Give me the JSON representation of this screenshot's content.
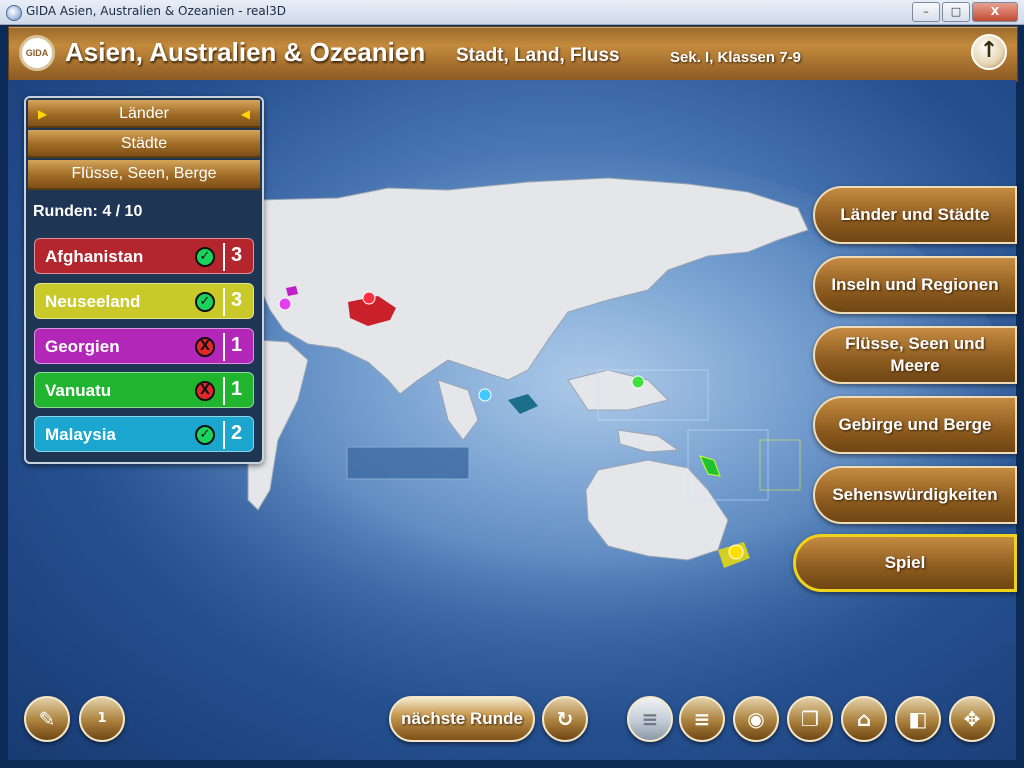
{
  "window": {
    "title": "GIDA Asien, Australien & Ozeanien - real3D",
    "minimize": "–",
    "maximize": "□",
    "close": "X"
  },
  "header": {
    "logo": "GIDA",
    "title": "Asien, Australien & Ozeanien",
    "subtitle": "Stadt, Land, Fluss",
    "level": "Sek. I, Klassen 7-9",
    "up_icon": "↑"
  },
  "panel": {
    "categories": [
      {
        "label": "Länder",
        "active": true
      },
      {
        "label": "Städte",
        "active": false
      },
      {
        "label": "Flüsse, Seen, Berge",
        "active": false
      }
    ],
    "rounds": "Runden: 4 / 10",
    "results": [
      {
        "name": "Afghanistan",
        "correct": true,
        "status": "✓",
        "points": "3",
        "color": "#b3262e"
      },
      {
        "name": "Neuseeland",
        "correct": true,
        "status": "✓",
        "points": "3",
        "color": "#c9c92a"
      },
      {
        "name": "Georgien",
        "correct": false,
        "status": "X",
        "points": "1",
        "color": "#b227b8"
      },
      {
        "name": "Vanuatu",
        "correct": false,
        "status": "X",
        "points": "1",
        "color": "#21b42f"
      },
      {
        "name": "Malaysia",
        "correct": true,
        "status": "✓",
        "points": "2",
        "color": "#1ba6cf"
      }
    ]
  },
  "right_menu": [
    "Länder und Städte",
    "Inseln und Regionen",
    "Flüsse, Seen und Meere",
    "Gebirge und Berge",
    "Sehenswürdigkeiten",
    "Spiel"
  ],
  "toolbar": {
    "next_round": "nächste Runde",
    "podium": "1",
    "icons": [
      "notepad-icon",
      "podium-icon",
      "reset-icon",
      "list-light-icon",
      "list-icon",
      "camera-icon",
      "copy-icon",
      "home-icon",
      "window-icon",
      "move-icon"
    ]
  }
}
